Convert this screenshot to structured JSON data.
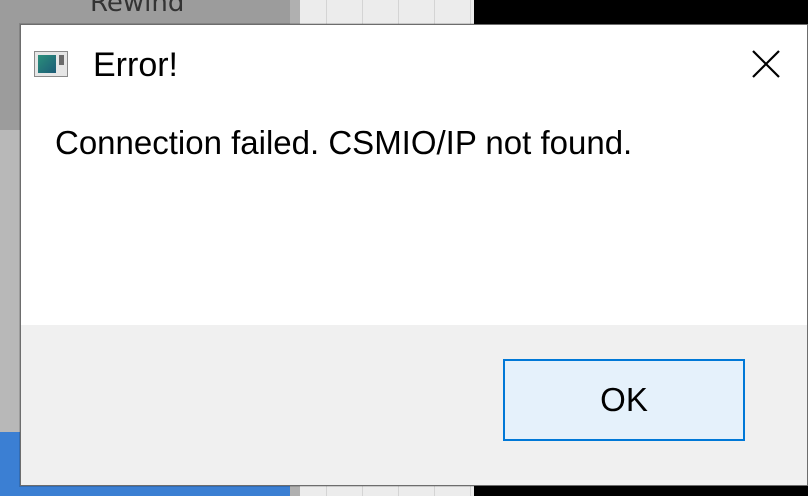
{
  "background": {
    "partial_label": "Rewind"
  },
  "dialog": {
    "title": "Error!",
    "message": "Connection failed. CSMIO/IP not found.",
    "ok_label": "OK",
    "icon": "app-window-icon",
    "close_icon": "close-icon",
    "colors": {
      "accent": "#0078d7",
      "button_bg": "#e5f1fb",
      "footer_bg": "#f0f0f0"
    }
  }
}
